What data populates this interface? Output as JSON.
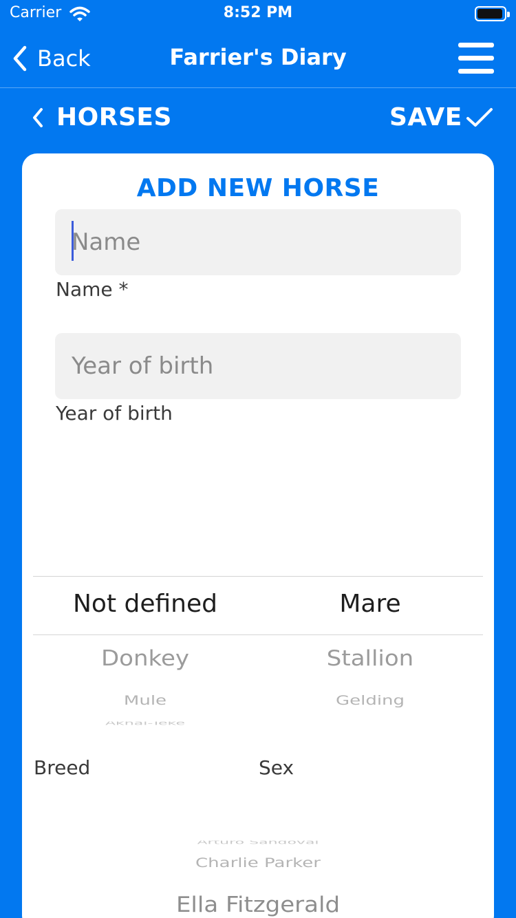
{
  "status_bar": {
    "carrier": "Carrier",
    "time": "8:52 PM",
    "icons": [
      "wifi-icon",
      "battery-icon"
    ]
  },
  "nav": {
    "back_label": "Back",
    "title": "Farrier's Diary",
    "menu_icon": "hamburger-menu-icon"
  },
  "header": {
    "horses_label": "HORSES",
    "save_label": "SAVE"
  },
  "form": {
    "title": "ADD NEW HORSE",
    "name": {
      "value": "",
      "placeholder": "Name",
      "label": "Name *"
    },
    "year_of_birth": {
      "value": "",
      "placeholder": "Year of birth",
      "label": "Year of birth"
    }
  },
  "breed_picker": {
    "label": "Breed",
    "selected": "Not defined",
    "options_below": [
      "Donkey",
      "Mule",
      "Akhal-Teke"
    ]
  },
  "sex_picker": {
    "label": "Sex",
    "selected": "Mare",
    "options_below": [
      "Stallion",
      "Gelding"
    ]
  },
  "owner_picker": {
    "options_above": [
      "Arturo Sandoval",
      "Charlie Parker"
    ],
    "selected": "Ella Fitzgerald"
  },
  "colors": {
    "accent": "#0278F0",
    "input_bg": "#F1F1F1",
    "card_bg": "#FFFFFF",
    "caret": "#3B5BDB"
  }
}
